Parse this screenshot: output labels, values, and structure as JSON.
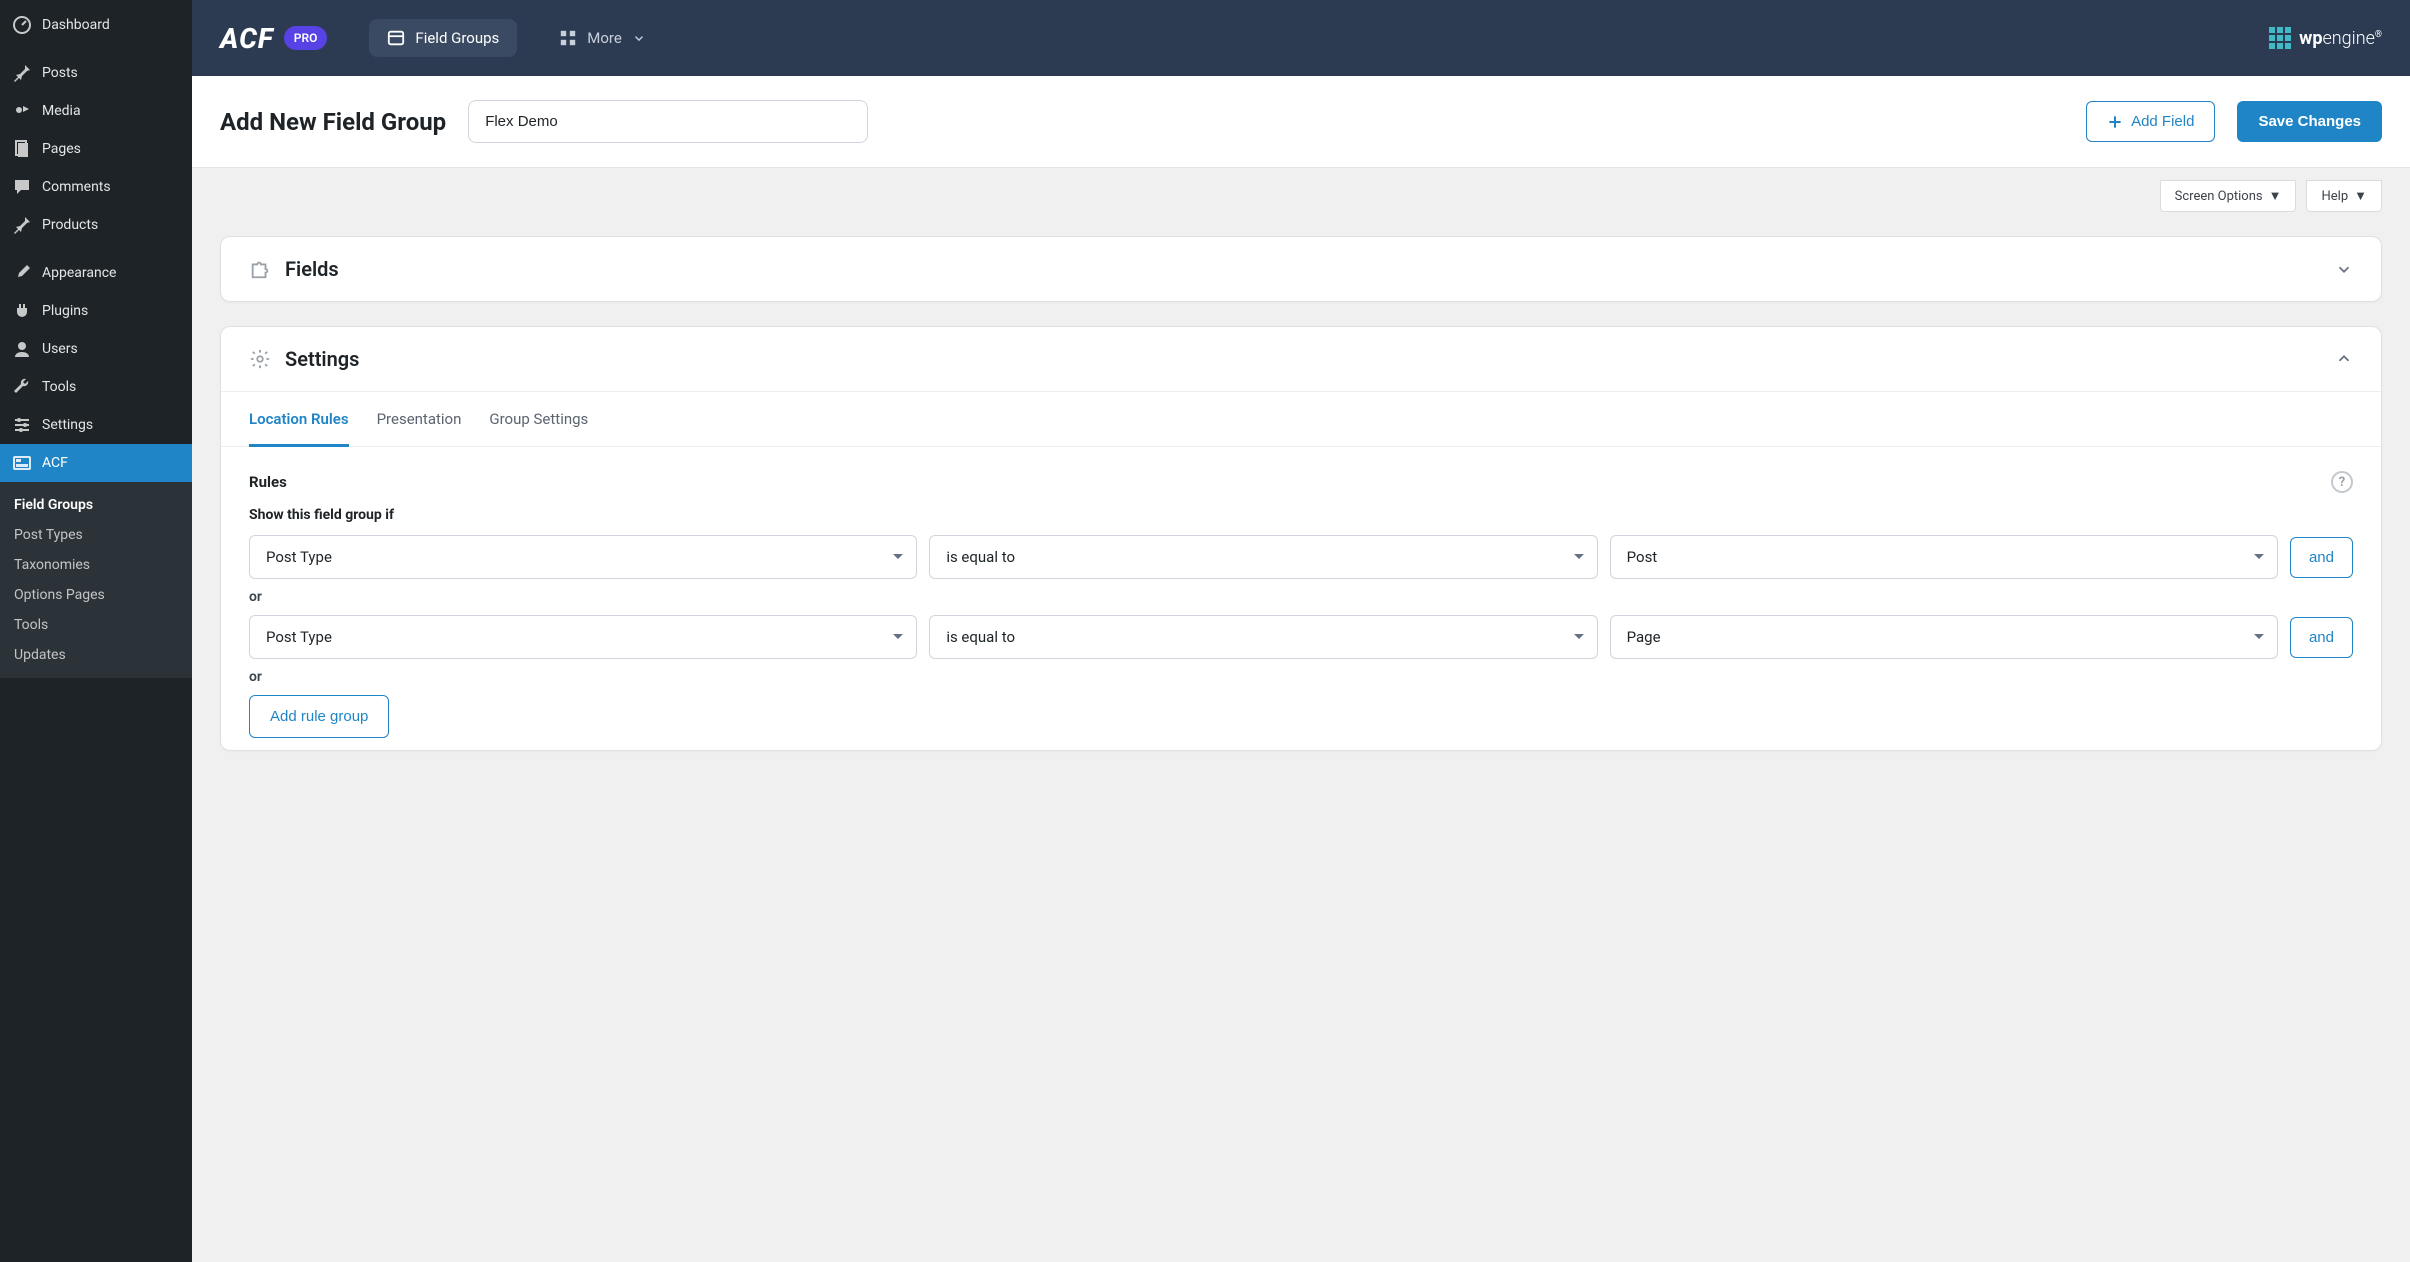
{
  "sidebar": {
    "items": [
      {
        "label": "Dashboard",
        "icon": "dashboard"
      },
      {
        "label": "Posts",
        "icon": "pin"
      },
      {
        "label": "Media",
        "icon": "media"
      },
      {
        "label": "Pages",
        "icon": "page"
      },
      {
        "label": "Comments",
        "icon": "comment"
      },
      {
        "label": "Products",
        "icon": "pin"
      }
    ],
    "items2": [
      {
        "label": "Appearance",
        "icon": "brush"
      },
      {
        "label": "Plugins",
        "icon": "plug"
      },
      {
        "label": "Users",
        "icon": "user"
      },
      {
        "label": "Tools",
        "icon": "wrench"
      },
      {
        "label": "Settings",
        "icon": "sliders"
      },
      {
        "label": "ACF",
        "icon": "acf",
        "active": true
      }
    ],
    "submenu": [
      "Field Groups",
      "Post Types",
      "Taxonomies",
      "Options Pages",
      "Tools",
      "Updates"
    ]
  },
  "topbar": {
    "logo": "ACF",
    "pro": "PRO",
    "nav_active": "Field Groups",
    "more": "More",
    "wpengine": "wpengine"
  },
  "header": {
    "title": "Add New Field Group",
    "input_value": "Flex Demo",
    "add_field": "Add Field",
    "save": "Save Changes"
  },
  "screen": {
    "options": "Screen Options",
    "help": "Help"
  },
  "panels": {
    "fields": "Fields",
    "settings": "Settings"
  },
  "tabs": [
    "Location Rules",
    "Presentation",
    "Group Settings"
  ],
  "rules": {
    "title": "Rules",
    "subtitle": "Show this field group if",
    "rows": [
      {
        "param": "Post Type",
        "op": "is equal to",
        "value": "Post"
      },
      {
        "param": "Post Type",
        "op": "is equal to",
        "value": "Page"
      }
    ],
    "or": "or",
    "and": "and",
    "add_group": "Add rule group"
  }
}
